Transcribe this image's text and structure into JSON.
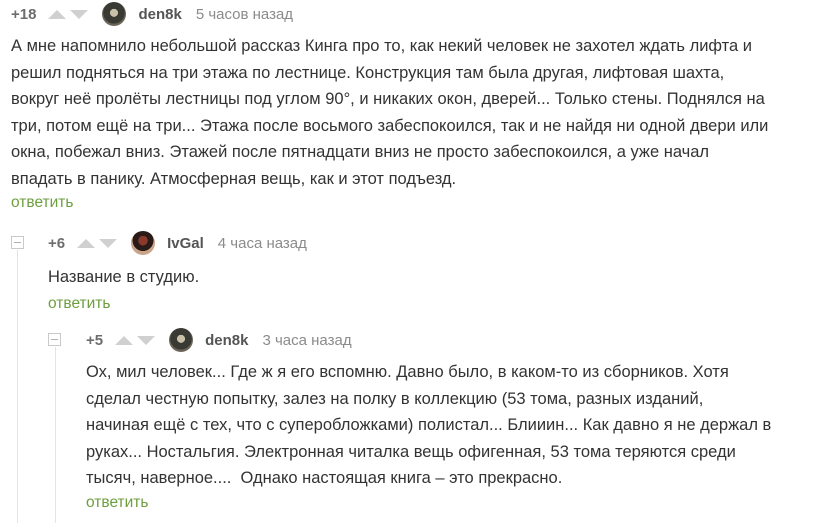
{
  "comments": [
    {
      "rating": "+18",
      "author": "den8k",
      "time": "5 часов назад",
      "lines": [
        "А мне напомнило небольшой рассказ Кинга про то, как некий человек не захотел ждать лифта и",
        "решил подняться на три этажа по лестнице. Конструкция там была другая, лифтовая шахта,",
        "вокруг неё пролёты лестницы под углом 90°, и никаких окон, дверей... Только стены. Поднялся на",
        "три, потом ещё на три... Этажа после восьмого забеспокоился, так и не найдя ни одной двери или",
        "окна, побежал вниз. Этажей после пятнадцати вниз не просто забеспокоился, а уже начал",
        "впадать в панику. Атмосферная вещь, как и этот подъезд."
      ],
      "reply": "ответить"
    },
    {
      "rating": "+6",
      "author": "IvGal",
      "time": "4 часа назад",
      "lines": [
        "Название в студию."
      ],
      "reply": "ответить"
    },
    {
      "rating": "+5",
      "author": "den8k",
      "time": "3 часа назад",
      "lines": [
        "Ох, мил человек... Где ж я его вспомню. Давно было, в каком-то из сборников. Хотя",
        "сделал честную попытку, залез на полку в коллекцию (53 тома, разных изданий,",
        "начиная ещё с тех, что с суперобложками) полистал... Блииин... Как давно я не держал в",
        "руках... Ностальгия. Электронная читалка вещь офигенная, 53 тома теряются среди",
        "тысяч, наверное....  Однако настоящая книга – это прекрасно."
      ],
      "reply": "ответить"
    }
  ]
}
